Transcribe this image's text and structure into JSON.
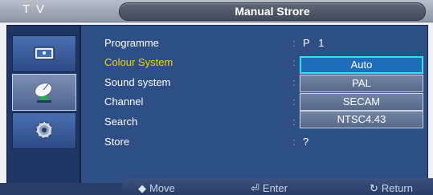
{
  "header": {
    "tv_label": "T V",
    "title": "Manual Strore"
  },
  "sidebar": {
    "items": [
      {
        "name": "picture",
        "icon": "picture-icon",
        "active": false
      },
      {
        "name": "sound",
        "icon": "satellite-dish-icon",
        "active": true
      },
      {
        "name": "setup",
        "icon": "gear-icon",
        "active": false
      }
    ]
  },
  "menu": {
    "rows": [
      {
        "label": "Programme",
        "colon": ":",
        "value": "P   1",
        "highlight": false
      },
      {
        "label": "Colour System",
        "colon": ":",
        "value": "",
        "highlight": true
      },
      {
        "label": "Sound system",
        "colon": ":",
        "value": "",
        "highlight": false
      },
      {
        "label": "Channel",
        "colon": ":",
        "value": "",
        "highlight": false
      },
      {
        "label": "Search",
        "colon": ":",
        "value": "",
        "highlight": false
      },
      {
        "label": "Store",
        "colon": ":",
        "value": "?",
        "highlight": false
      }
    ]
  },
  "dropdown": {
    "options": [
      "Auto",
      "PAL",
      "SECAM",
      "NTSC4.43"
    ],
    "selected": "Auto"
  },
  "footer": {
    "move": "Move",
    "move_icon": "up-down-arrows-icon",
    "enter": "Enter",
    "enter_icon": "enter-icon",
    "return": "Return",
    "return_icon": "return-icon"
  },
  "colors": {
    "highlight_text": "#f3d11a",
    "selected_border": "#2ee1ea"
  }
}
